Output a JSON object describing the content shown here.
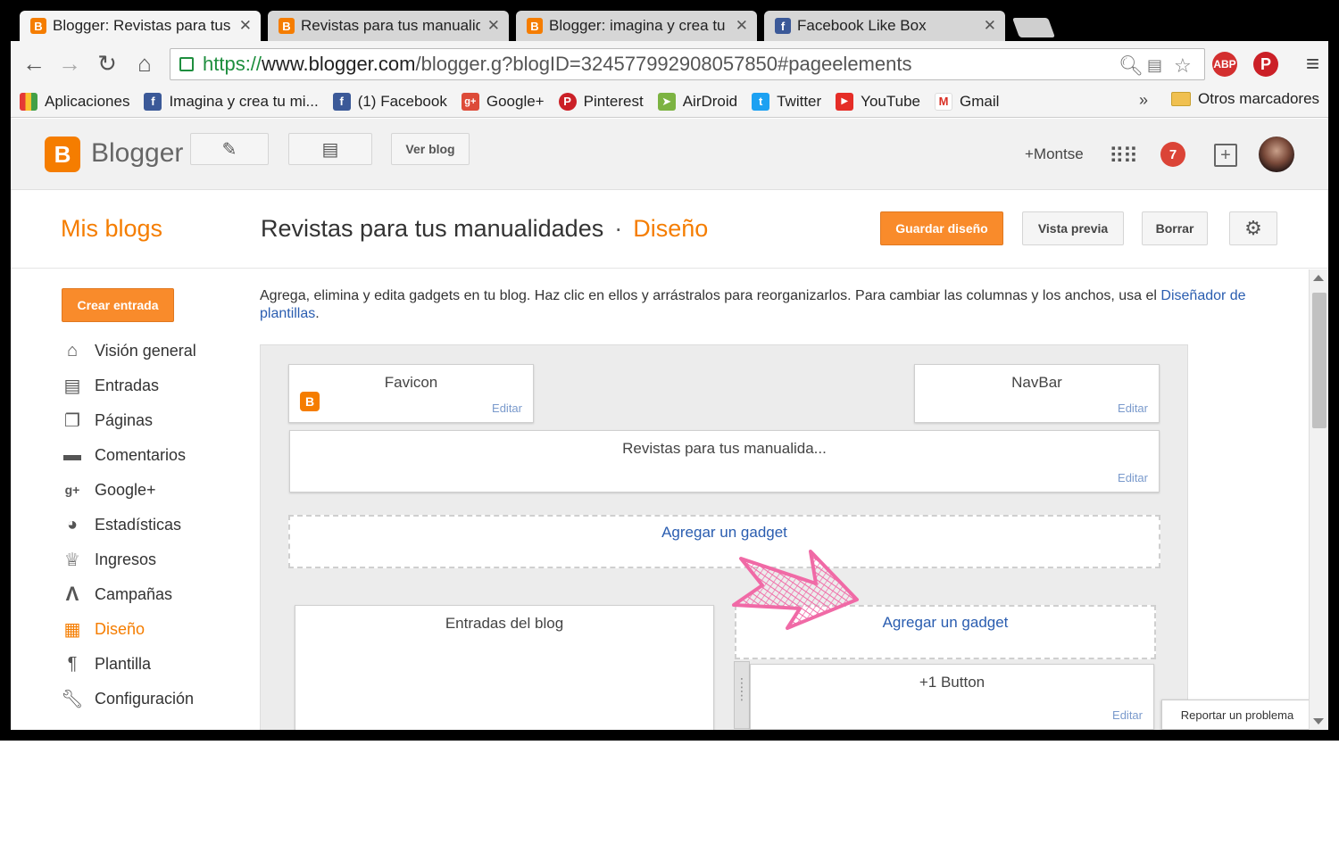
{
  "colors": {
    "accent": "#f57d00",
    "button_orange": "#f98b2b",
    "link_blue": "#2a5db0",
    "arrow_pink": "#f06aa6"
  },
  "tabs": [
    {
      "title": "Blogger: Revistas para tus",
      "icon": "blogger-icon",
      "active": true
    },
    {
      "title": "Revistas para tus manualid",
      "icon": "blogger-icon",
      "active": false
    },
    {
      "title": "Blogger: imagina y crea tu",
      "icon": "blogger-icon",
      "active": false
    },
    {
      "title": "Facebook Like Box",
      "icon": "facebook-icon",
      "active": false
    }
  ],
  "toolbar": {
    "url_scheme": "https://",
    "url_host": "www.blogger.com",
    "url_path": "/blogger.g?blogID=324577992908057850#pageelements",
    "adblock_label": "ABP"
  },
  "bookmarks": [
    {
      "label": "Aplicaciones",
      "icon": "apps-grid-icon"
    },
    {
      "label": "Imagina y crea tu mi...",
      "icon": "facebook-icon"
    },
    {
      "label": "(1) Facebook",
      "icon": "facebook-icon"
    },
    {
      "label": "Google+",
      "icon": "google-plus-icon"
    },
    {
      "label": "Pinterest",
      "icon": "pinterest-icon"
    },
    {
      "label": "AirDroid",
      "icon": "airdroid-icon"
    },
    {
      "label": "Twitter",
      "icon": "twitter-icon"
    },
    {
      "label": "YouTube",
      "icon": "youtube-icon"
    },
    {
      "label": "Gmail",
      "icon": "gmail-icon"
    }
  ],
  "bookmarks_more": "»",
  "bookmarks_other": "Otros marcadores",
  "header": {
    "logo_text": "Blogger",
    "ver_blog": "Ver blog",
    "user": "+Montse",
    "notifications": "7"
  },
  "title_row": {
    "mis_blogs": "Mis blogs",
    "blog_name": "Revistas para tus manualidades",
    "separator": "·",
    "section": "Diseño",
    "guardar": "Guardar diseño",
    "vista_previa": "Vista previa",
    "borrar": "Borrar"
  },
  "sidebar": {
    "crear_entrada": "Crear entrada",
    "items": [
      {
        "label": "Visión general",
        "icon": "home-icon",
        "active": false
      },
      {
        "label": "Entradas",
        "icon": "posts-icon",
        "active": false
      },
      {
        "label": "Páginas",
        "icon": "pages-icon",
        "active": false
      },
      {
        "label": "Comentarios",
        "icon": "comments-icon",
        "active": false
      },
      {
        "label": "Google+",
        "icon": "google-plus-icon",
        "active": false
      },
      {
        "label": "Estadísticas",
        "icon": "stats-icon",
        "active": false
      },
      {
        "label": "Ingresos",
        "icon": "trophy-icon",
        "active": false
      },
      {
        "label": "Campañas",
        "icon": "campaigns-icon",
        "active": false
      },
      {
        "label": "Diseño",
        "icon": "layout-icon",
        "active": true
      },
      {
        "label": "Plantilla",
        "icon": "template-icon",
        "active": false
      },
      {
        "label": "Configuración",
        "icon": "wrench-icon",
        "active": false
      }
    ]
  },
  "main": {
    "intro": "Agrega, elimina y edita gadgets en tu blog. Haz clic en ellos y arrástralos para reorganizarlos. Para cambiar las columnas y los anchos, usa el",
    "intro_link": "Diseñador de plantillas",
    "intro_end": ".",
    "gadgets": {
      "favicon": "Favicon",
      "navbar": "NavBar",
      "header": "Revistas para tus manualida...",
      "entradas": "Entradas del blog",
      "plus_one": "+1 Button",
      "edit_label": "Editar"
    },
    "add_gadget": "Agregar un gadget",
    "report": "Reportar un problema"
  }
}
